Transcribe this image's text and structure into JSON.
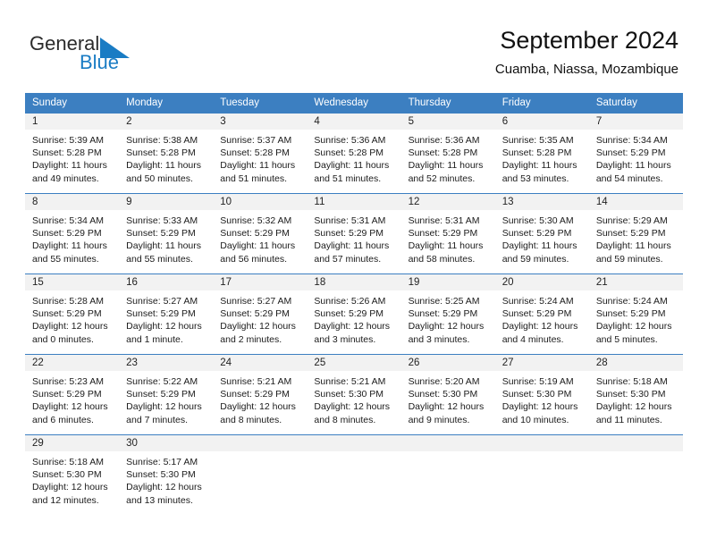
{
  "brand": {
    "name_part1": "General",
    "name_part2": "Blue",
    "logo_icon": "blue-triangle-flag-icon",
    "accent_color": "#1a7cc4"
  },
  "header": {
    "title": "September 2024",
    "subtitle": "Cuamba, Niassa, Mozambique"
  },
  "calendar": {
    "header_bg_color": "#3c7fc1",
    "daynum_band_color": "#f2f2f2",
    "weekday_headers": [
      "Sunday",
      "Monday",
      "Tuesday",
      "Wednesday",
      "Thursday",
      "Friday",
      "Saturday"
    ],
    "weeks": [
      [
        {
          "day": "1",
          "sunrise": "Sunrise: 5:39 AM",
          "sunset": "Sunset: 5:28 PM",
          "daylight_line1": "Daylight: 11 hours",
          "daylight_line2": "and 49 minutes."
        },
        {
          "day": "2",
          "sunrise": "Sunrise: 5:38 AM",
          "sunset": "Sunset: 5:28 PM",
          "daylight_line1": "Daylight: 11 hours",
          "daylight_line2": "and 50 minutes."
        },
        {
          "day": "3",
          "sunrise": "Sunrise: 5:37 AM",
          "sunset": "Sunset: 5:28 PM",
          "daylight_line1": "Daylight: 11 hours",
          "daylight_line2": "and 51 minutes."
        },
        {
          "day": "4",
          "sunrise": "Sunrise: 5:36 AM",
          "sunset": "Sunset: 5:28 PM",
          "daylight_line1": "Daylight: 11 hours",
          "daylight_line2": "and 51 minutes."
        },
        {
          "day": "5",
          "sunrise": "Sunrise: 5:36 AM",
          "sunset": "Sunset: 5:28 PM",
          "daylight_line1": "Daylight: 11 hours",
          "daylight_line2": "and 52 minutes."
        },
        {
          "day": "6",
          "sunrise": "Sunrise: 5:35 AM",
          "sunset": "Sunset: 5:28 PM",
          "daylight_line1": "Daylight: 11 hours",
          "daylight_line2": "and 53 minutes."
        },
        {
          "day": "7",
          "sunrise": "Sunrise: 5:34 AM",
          "sunset": "Sunset: 5:29 PM",
          "daylight_line1": "Daylight: 11 hours",
          "daylight_line2": "and 54 minutes."
        }
      ],
      [
        {
          "day": "8",
          "sunrise": "Sunrise: 5:34 AM",
          "sunset": "Sunset: 5:29 PM",
          "daylight_line1": "Daylight: 11 hours",
          "daylight_line2": "and 55 minutes."
        },
        {
          "day": "9",
          "sunrise": "Sunrise: 5:33 AM",
          "sunset": "Sunset: 5:29 PM",
          "daylight_line1": "Daylight: 11 hours",
          "daylight_line2": "and 55 minutes."
        },
        {
          "day": "10",
          "sunrise": "Sunrise: 5:32 AM",
          "sunset": "Sunset: 5:29 PM",
          "daylight_line1": "Daylight: 11 hours",
          "daylight_line2": "and 56 minutes."
        },
        {
          "day": "11",
          "sunrise": "Sunrise: 5:31 AM",
          "sunset": "Sunset: 5:29 PM",
          "daylight_line1": "Daylight: 11 hours",
          "daylight_line2": "and 57 minutes."
        },
        {
          "day": "12",
          "sunrise": "Sunrise: 5:31 AM",
          "sunset": "Sunset: 5:29 PM",
          "daylight_line1": "Daylight: 11 hours",
          "daylight_line2": "and 58 minutes."
        },
        {
          "day": "13",
          "sunrise": "Sunrise: 5:30 AM",
          "sunset": "Sunset: 5:29 PM",
          "daylight_line1": "Daylight: 11 hours",
          "daylight_line2": "and 59 minutes."
        },
        {
          "day": "14",
          "sunrise": "Sunrise: 5:29 AM",
          "sunset": "Sunset: 5:29 PM",
          "daylight_line1": "Daylight: 11 hours",
          "daylight_line2": "and 59 minutes."
        }
      ],
      [
        {
          "day": "15",
          "sunrise": "Sunrise: 5:28 AM",
          "sunset": "Sunset: 5:29 PM",
          "daylight_line1": "Daylight: 12 hours",
          "daylight_line2": "and 0 minutes."
        },
        {
          "day": "16",
          "sunrise": "Sunrise: 5:27 AM",
          "sunset": "Sunset: 5:29 PM",
          "daylight_line1": "Daylight: 12 hours",
          "daylight_line2": "and 1 minute."
        },
        {
          "day": "17",
          "sunrise": "Sunrise: 5:27 AM",
          "sunset": "Sunset: 5:29 PM",
          "daylight_line1": "Daylight: 12 hours",
          "daylight_line2": "and 2 minutes."
        },
        {
          "day": "18",
          "sunrise": "Sunrise: 5:26 AM",
          "sunset": "Sunset: 5:29 PM",
          "daylight_line1": "Daylight: 12 hours",
          "daylight_line2": "and 3 minutes."
        },
        {
          "day": "19",
          "sunrise": "Sunrise: 5:25 AM",
          "sunset": "Sunset: 5:29 PM",
          "daylight_line1": "Daylight: 12 hours",
          "daylight_line2": "and 3 minutes."
        },
        {
          "day": "20",
          "sunrise": "Sunrise: 5:24 AM",
          "sunset": "Sunset: 5:29 PM",
          "daylight_line1": "Daylight: 12 hours",
          "daylight_line2": "and 4 minutes."
        },
        {
          "day": "21",
          "sunrise": "Sunrise: 5:24 AM",
          "sunset": "Sunset: 5:29 PM",
          "daylight_line1": "Daylight: 12 hours",
          "daylight_line2": "and 5 minutes."
        }
      ],
      [
        {
          "day": "22",
          "sunrise": "Sunrise: 5:23 AM",
          "sunset": "Sunset: 5:29 PM",
          "daylight_line1": "Daylight: 12 hours",
          "daylight_line2": "and 6 minutes."
        },
        {
          "day": "23",
          "sunrise": "Sunrise: 5:22 AM",
          "sunset": "Sunset: 5:29 PM",
          "daylight_line1": "Daylight: 12 hours",
          "daylight_line2": "and 7 minutes."
        },
        {
          "day": "24",
          "sunrise": "Sunrise: 5:21 AM",
          "sunset": "Sunset: 5:29 PM",
          "daylight_line1": "Daylight: 12 hours",
          "daylight_line2": "and 8 minutes."
        },
        {
          "day": "25",
          "sunrise": "Sunrise: 5:21 AM",
          "sunset": "Sunset: 5:30 PM",
          "daylight_line1": "Daylight: 12 hours",
          "daylight_line2": "and 8 minutes."
        },
        {
          "day": "26",
          "sunrise": "Sunrise: 5:20 AM",
          "sunset": "Sunset: 5:30 PM",
          "daylight_line1": "Daylight: 12 hours",
          "daylight_line2": "and 9 minutes."
        },
        {
          "day": "27",
          "sunrise": "Sunrise: 5:19 AM",
          "sunset": "Sunset: 5:30 PM",
          "daylight_line1": "Daylight: 12 hours",
          "daylight_line2": "and 10 minutes."
        },
        {
          "day": "28",
          "sunrise": "Sunrise: 5:18 AM",
          "sunset": "Sunset: 5:30 PM",
          "daylight_line1": "Daylight: 12 hours",
          "daylight_line2": "and 11 minutes."
        }
      ],
      [
        {
          "day": "29",
          "sunrise": "Sunrise: 5:18 AM",
          "sunset": "Sunset: 5:30 PM",
          "daylight_line1": "Daylight: 12 hours",
          "daylight_line2": "and 12 minutes."
        },
        {
          "day": "30",
          "sunrise": "Sunrise: 5:17 AM",
          "sunset": "Sunset: 5:30 PM",
          "daylight_line1": "Daylight: 12 hours",
          "daylight_line2": "and 13 minutes."
        },
        {
          "day": "",
          "sunrise": "",
          "sunset": "",
          "daylight_line1": "",
          "daylight_line2": ""
        },
        {
          "day": "",
          "sunrise": "",
          "sunset": "",
          "daylight_line1": "",
          "daylight_line2": ""
        },
        {
          "day": "",
          "sunrise": "",
          "sunset": "",
          "daylight_line1": "",
          "daylight_line2": ""
        },
        {
          "day": "",
          "sunrise": "",
          "sunset": "",
          "daylight_line1": "",
          "daylight_line2": ""
        },
        {
          "day": "",
          "sunrise": "",
          "sunset": "",
          "daylight_line1": "",
          "daylight_line2": ""
        }
      ]
    ]
  }
}
